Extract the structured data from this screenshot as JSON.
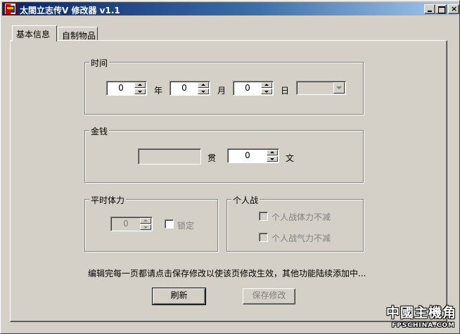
{
  "window": {
    "title": "太閤立志传Ⅴ 修改器 v1.1"
  },
  "tabs": [
    {
      "label": "基本信息",
      "selected": true
    },
    {
      "label": "自制物品",
      "selected": false
    }
  ],
  "time": {
    "group_label": "时间",
    "year_value": "0",
    "year_label": "年",
    "month_value": "0",
    "month_label": "月",
    "day_value": "0",
    "day_label": "日",
    "weekday_value": ""
  },
  "money": {
    "group_label": "金钱",
    "guan_value": "",
    "guan_label": "贯",
    "wen_value": "0",
    "wen_label": "文"
  },
  "stamina": {
    "group_label": "平时体力",
    "value": "0",
    "lock_label": "锁定",
    "locked": false
  },
  "duel": {
    "group_label": "个人战",
    "no_decrease_stamina_label": "个人战体力不减",
    "no_decrease_spirit_label": "个人战气力不减"
  },
  "note": "编辑完每一页都请点击保存修改以使该页修改生效，其他功能陆续添加中...",
  "buttons": {
    "refresh": "刷新",
    "save": "保存修改"
  },
  "watermark": {
    "text": "中國主機角",
    "sub": "FPSCHINA.COM"
  }
}
